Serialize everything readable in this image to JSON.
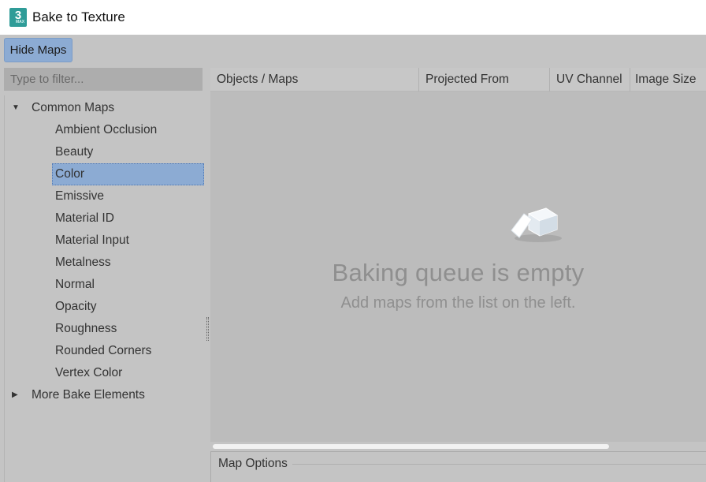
{
  "window": {
    "title": "Bake to Texture",
    "app_icon": "3ds-max-icon",
    "app_icon_text": "3",
    "app_icon_subtext": "MAX"
  },
  "toolbar": {
    "hide_maps_label": "Hide Maps"
  },
  "filter": {
    "placeholder": "Type to filter..."
  },
  "tree": {
    "groups": [
      {
        "label": "Common Maps",
        "expanded": true,
        "items": [
          "Ambient Occlusion",
          "Beauty",
          "Color",
          "Emissive",
          "Material ID",
          "Material Input",
          "Metalness",
          "Normal",
          "Opacity",
          "Roughness",
          "Rounded Corners",
          "Vertex Color"
        ],
        "selected": "Color"
      },
      {
        "label": "More Bake Elements",
        "expanded": false
      }
    ]
  },
  "table": {
    "columns": [
      "Objects / Maps",
      "Projected From",
      "UV Channel",
      "Image Size"
    ]
  },
  "queue": {
    "empty_icon": "empty-box-icon",
    "empty_title": "Baking queue is empty",
    "empty_subtitle": "Add maps from the list on the left."
  },
  "map_options": {
    "label": "Map Options"
  },
  "colors": {
    "accent": "#8cabd3",
    "background": "#c4c4c4"
  }
}
